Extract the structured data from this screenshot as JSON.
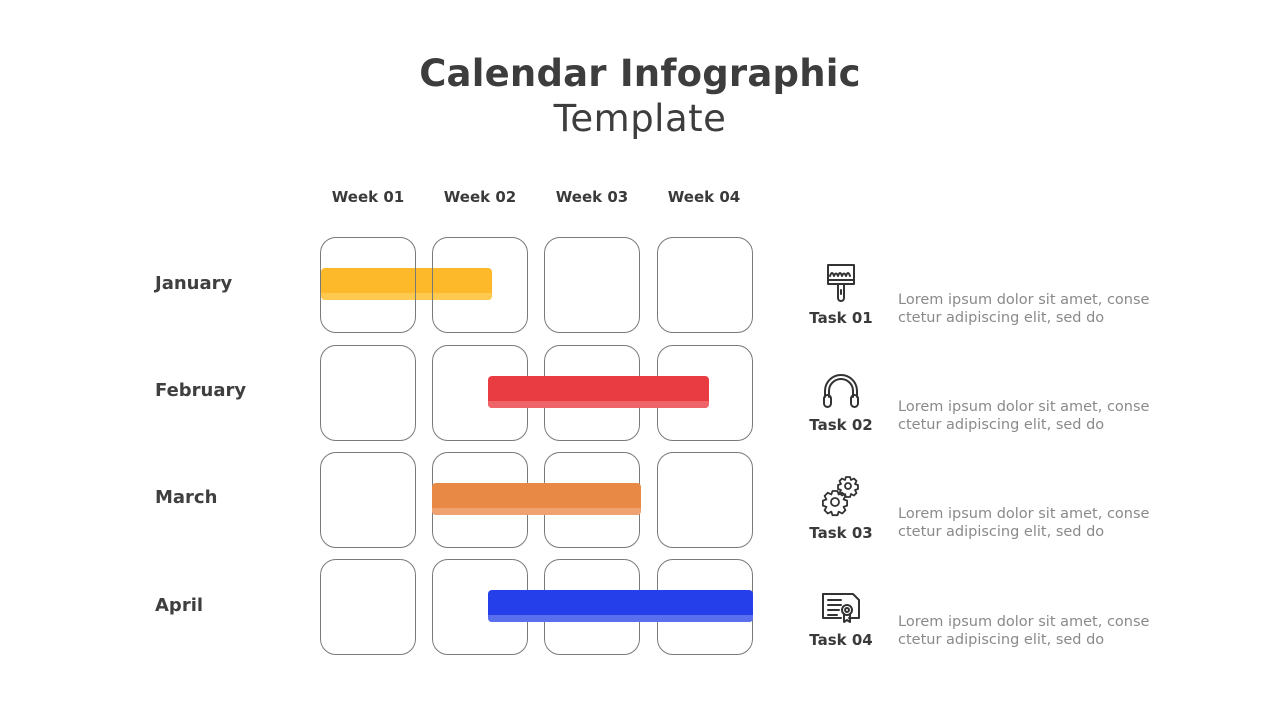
{
  "header": {
    "title": "Calendar Infographic",
    "subtitle": "Template"
  },
  "weeks": [
    "Week 01",
    "Week 02",
    "Week 03",
    "Week 04"
  ],
  "months": [
    "January",
    "February",
    "March",
    "April"
  ],
  "chart_data": {
    "type": "gantt",
    "title": "Calendar Infographic Template",
    "columns": [
      "Week 01",
      "Week 02",
      "Week 03",
      "Week 04"
    ],
    "rows": [
      "January",
      "February",
      "March",
      "April"
    ],
    "bars": [
      {
        "row": "January",
        "start_week": 1.0,
        "end_week": 2.5,
        "color": "#FDB92A",
        "shade": "#FDC94E"
      },
      {
        "row": "February",
        "start_week": 2.5,
        "end_week": 4.5,
        "color": "#E93C42",
        "shade": "#EF6468"
      },
      {
        "row": "March",
        "start_week": 2.0,
        "end_week": 4.0,
        "color": "#E88945",
        "shade": "#EFA271"
      },
      {
        "row": "April",
        "start_week": 2.5,
        "end_week": 5.0,
        "color": "#2540EA",
        "shade": "#5A6FEE"
      }
    ]
  },
  "tasks": [
    {
      "label": "Task 01",
      "icon": "paint-brush-icon",
      "description_line1": "Lorem ipsum dolor sit amet, conse",
      "description_line2": "ctetur adipiscing elit, sed do"
    },
    {
      "label": "Task 02",
      "icon": "headphones-icon",
      "description_line1": "Lorem ipsum dolor sit amet, conse",
      "description_line2": "ctetur adipiscing elit, sed do"
    },
    {
      "label": "Task 03",
      "icon": "gears-icon",
      "description_line1": "Lorem ipsum dolor sit amet, conse",
      "description_line2": "ctetur adipiscing elit, sed do"
    },
    {
      "label": "Task 04",
      "icon": "certificate-icon",
      "description_line1": "Lorem ipsum dolor sit amet, conse",
      "description_line2": "ctetur adipiscing elit, sed do"
    }
  ]
}
